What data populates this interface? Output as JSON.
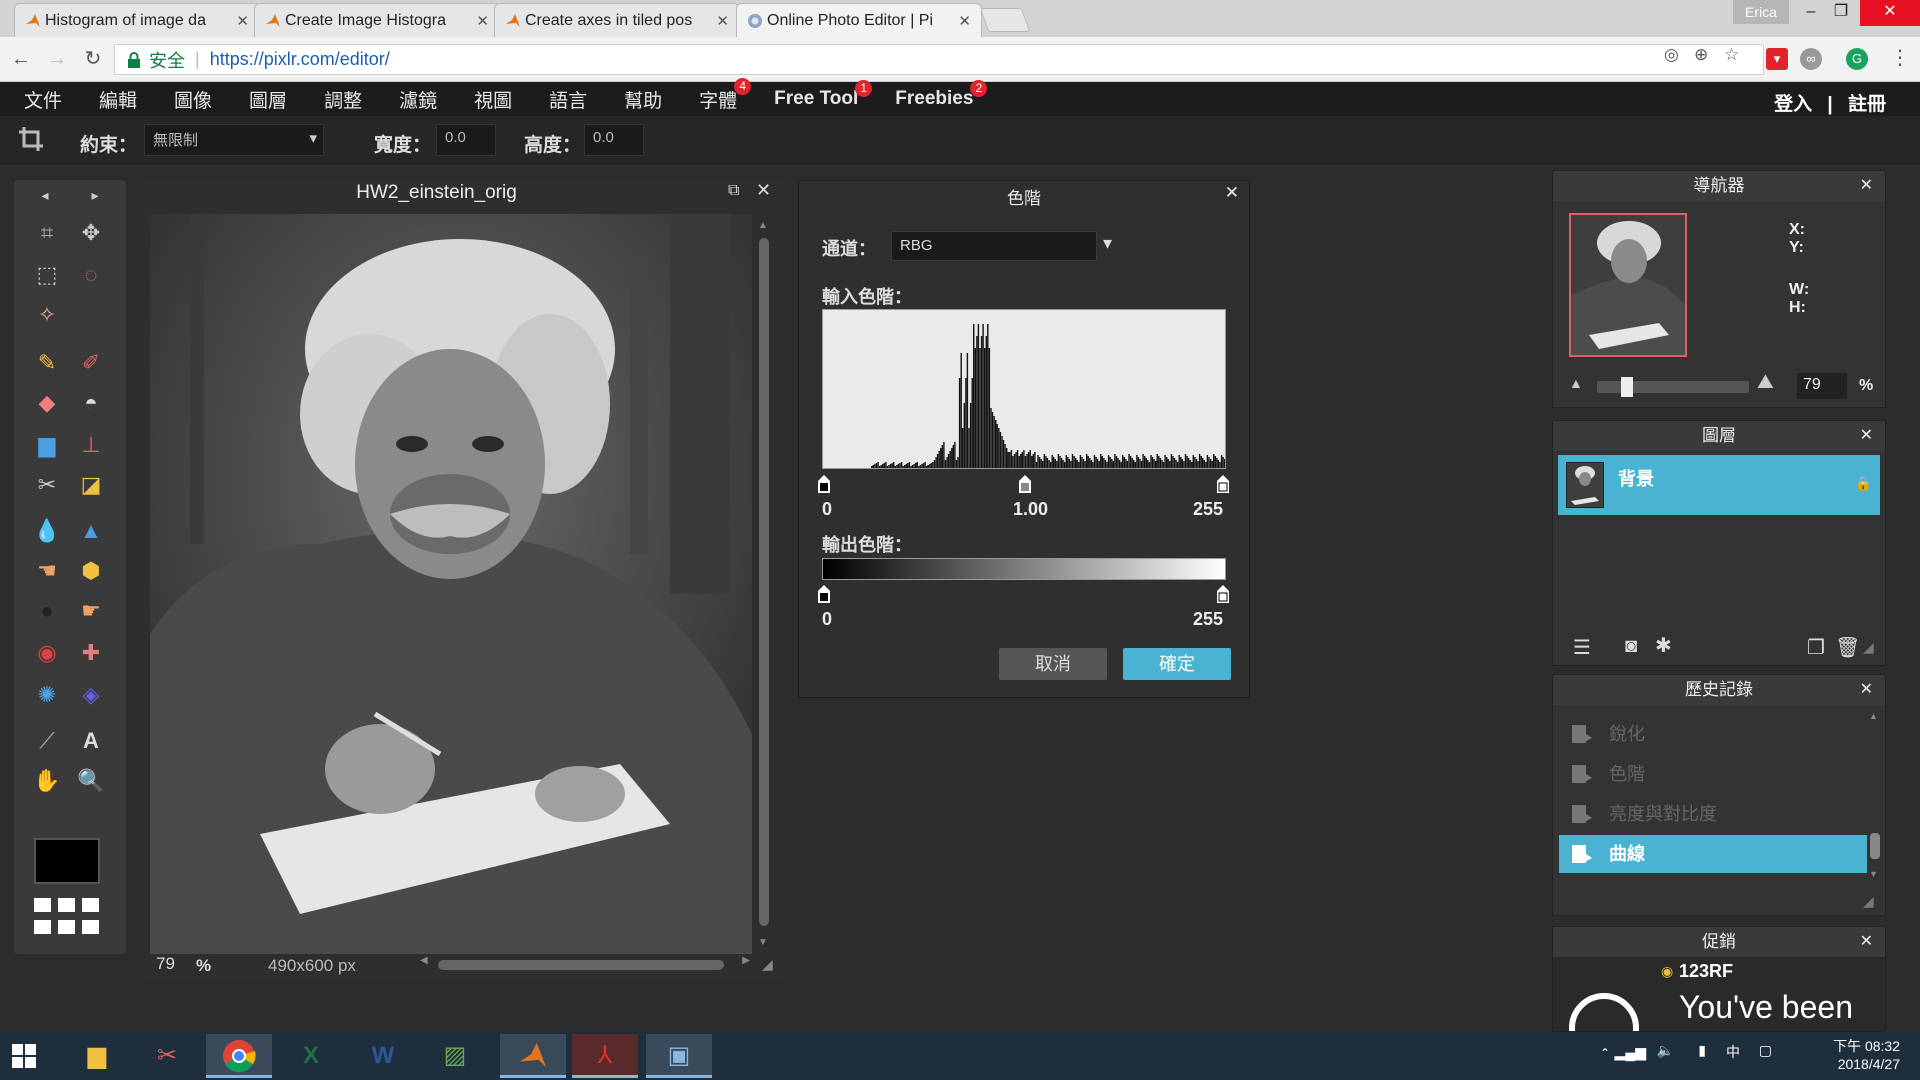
{
  "browser": {
    "tabs": [
      {
        "title": "Histogram of image da",
        "active": false
      },
      {
        "title": "Create Image Histogra",
        "active": false
      },
      {
        "title": "Create axes in tiled pos",
        "active": false
      },
      {
        "title": "Online Photo Editor | Pi",
        "active": true
      }
    ],
    "user": "Erica",
    "secure_label": "安全",
    "url": "https://pixlr.com/editor/"
  },
  "menu": {
    "items": [
      "文件",
      "編輯",
      "圖像",
      "圖層",
      "調整",
      "濾鏡",
      "視圖",
      "語言",
      "幫助"
    ],
    "font_item": {
      "label": "字體",
      "badge": "4"
    },
    "free_tool": {
      "label": "Free Tool",
      "badge": "1"
    },
    "freebies": {
      "label": "Freebies",
      "badge": "2"
    },
    "login": "登入",
    "separator": "|",
    "register": "註冊"
  },
  "options": {
    "constraint_label": "約束：",
    "constraint_value": "無限制",
    "width_label": "寬度：",
    "width_value": "0.0",
    "height_label": "高度：",
    "height_value": "0.0"
  },
  "image_window": {
    "title": "HW2_einstein_orig",
    "zoom": "79",
    "zoom_unit": "%",
    "dimensions": "490x600 px"
  },
  "levels": {
    "title": "色階",
    "channel_label": "通道：",
    "channel_value": "RBG",
    "input_label": "輸入色階：",
    "input_min": "0",
    "input_mid": "1.00",
    "input_max": "255",
    "output_label": "輸出色階：",
    "output_min": "0",
    "output_max": "255",
    "cancel": "取消",
    "ok": "確定"
  },
  "navigator": {
    "title": "導航器",
    "x_label": "X:",
    "y_label": "Y:",
    "w_label": "W:",
    "h_label": "H:",
    "zoom_value": "79",
    "zoom_unit": "%"
  },
  "layers": {
    "title": "圖層",
    "items": [
      {
        "name": "背景"
      }
    ]
  },
  "history": {
    "title": "歷史記錄",
    "items": [
      "銳化",
      "色階",
      "亮度與對比度",
      "曲線"
    ]
  },
  "promo": {
    "title": "促銷",
    "brand": "123RF",
    "text": "You've been"
  },
  "taskbar": {
    "time": "下午 08:32",
    "date": "2018/4/27",
    "ime": "中"
  },
  "colors": {
    "accent": "#4ab3d2",
    "badge": "#e0242b",
    "bg": "#2c2c2c"
  }
}
